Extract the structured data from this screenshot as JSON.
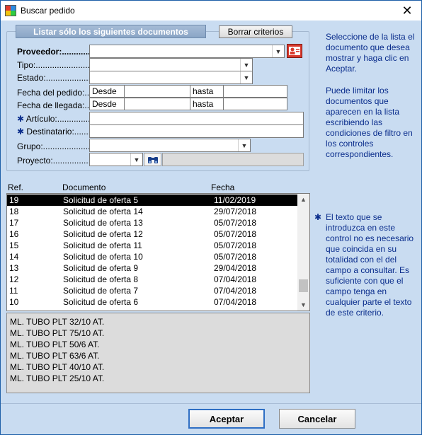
{
  "window": {
    "title": "Buscar pedido",
    "close": "✕"
  },
  "filter": {
    "legend": "Listar sólo los siguientes documentos",
    "clear_button": "Borrar criterios",
    "proveedor_label": "Proveedor:......................",
    "tipo_label": "Tipo:.................................",
    "estado_label": "Estado:............................",
    "fecha_pedido_label": "Fecha del pedido:..",
    "fecha_llegada_label": "Fecha de llegada:..",
    "desde": "Desde",
    "hasta": "hasta",
    "articulo_label": "Artículo:.....................",
    "destinatario_label": "Destinatario:...........",
    "grupo_label": "Grupo:...............................",
    "proyecto_label": "Proyecto:..........................."
  },
  "list": {
    "columns": [
      "Ref.",
      "Documento",
      "Fecha"
    ],
    "rows": [
      [
        "19",
        "Solicitud de oferta 5",
        "11/02/2019"
      ],
      [
        "18",
        "Solicitud de oferta 14",
        "29/07/2018"
      ],
      [
        "17",
        "Solicitud de oferta 13",
        "05/07/2018"
      ],
      [
        "16",
        "Solicitud de oferta 12",
        "05/07/2018"
      ],
      [
        "15",
        "Solicitud de oferta 11",
        "05/07/2018"
      ],
      [
        "14",
        "Solicitud de oferta 10",
        "05/07/2018"
      ],
      [
        "13",
        "Solicitud de oferta 9",
        "29/04/2018"
      ],
      [
        "12",
        "Solicitud de oferta 8",
        "07/04/2018"
      ],
      [
        "11",
        "Solicitud de oferta 7",
        "07/04/2018"
      ],
      [
        "10",
        "Solicitud de oferta 6",
        "07/04/2018"
      ]
    ],
    "selected_index": 0
  },
  "detail": {
    "lines": [
      "ML. TUBO PLT 32/10 AT.",
      "ML. TUBO PLT 75/10 AT.",
      "ML. TUBO PLT 50/6 AT.",
      "ML. TUBO PLT 63/6 AT.",
      "ML. TUBO PLT 40/10 AT.",
      "ML. TUBO PLT 25/10 AT."
    ]
  },
  "help": {
    "p1": "Seleccione de la lista el documento que desea mostrar y haga clic en Aceptar.",
    "p2": "Puede limitar los documentos que aparecen en la lista escribiendo las condiciones de filtro en los controles correspondientes.",
    "p3": "El texto que se introduzca en este control no es necesario que coincida en su totalidad con el del campo a consultar. Es suficiente con que el campo tenga en cualquier parte el texto de este criterio."
  },
  "buttons": {
    "accept": "Aceptar",
    "cancel": "Cancelar"
  },
  "icons": {
    "star": "✱",
    "dropdown": "chevron-down",
    "contact": "contact-card",
    "search": "binoculars"
  }
}
